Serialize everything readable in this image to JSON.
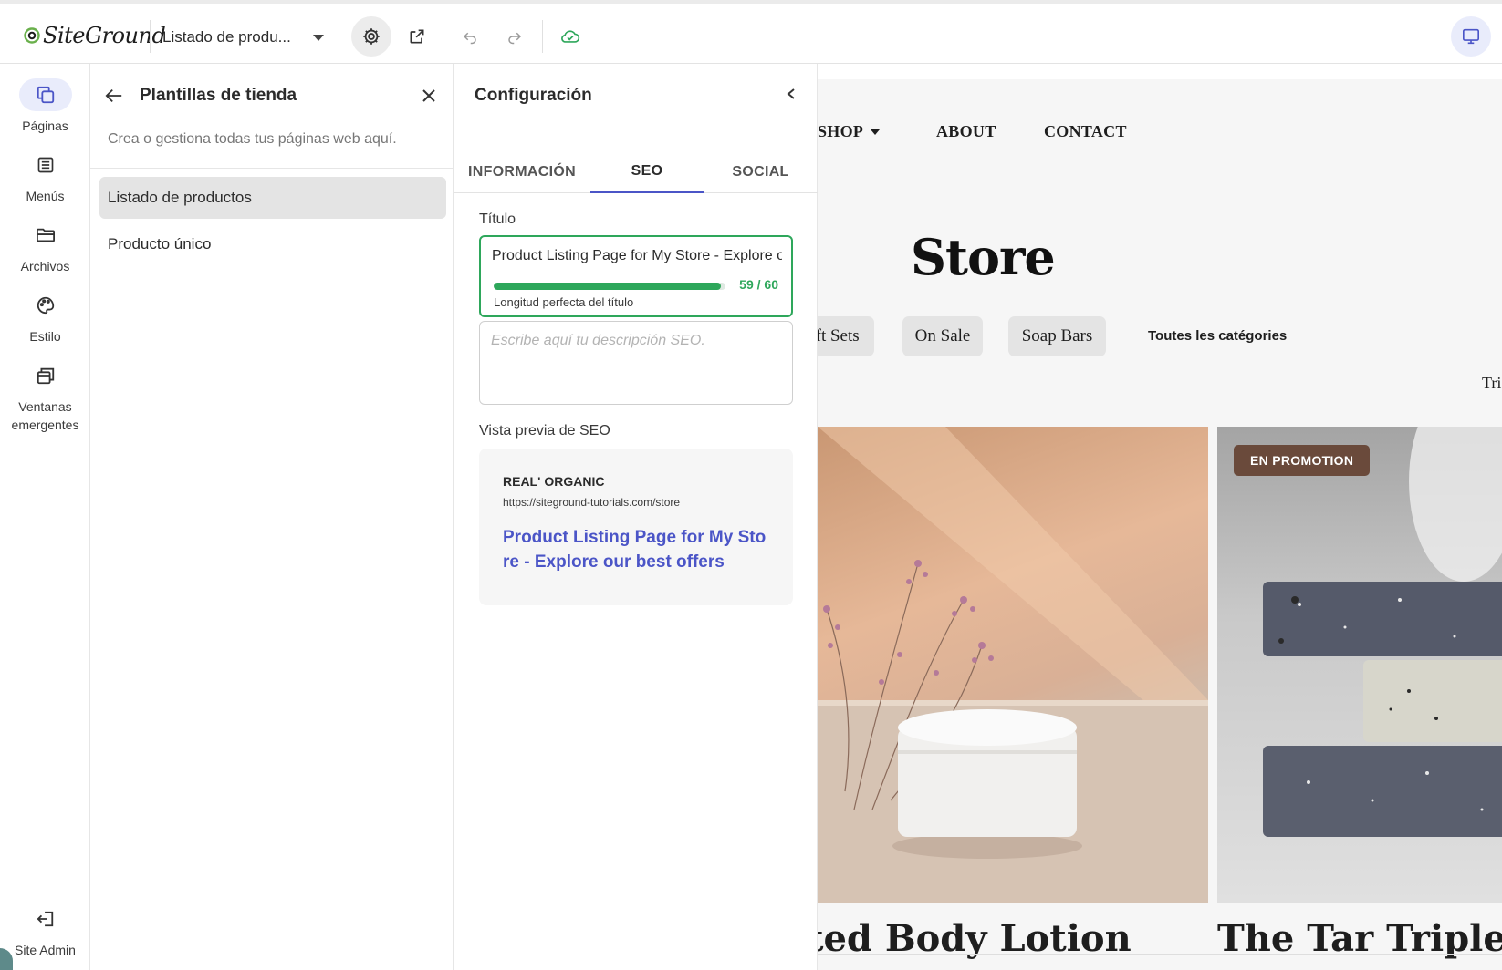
{
  "topbar": {
    "logo_text": "SiteGround",
    "page_select": "Listado de produ...",
    "icons": [
      "settings-icon",
      "open-external-icon",
      "undo-icon",
      "redo-icon",
      "cloud-saved-icon",
      "desktop-view-icon"
    ]
  },
  "rail": {
    "items": [
      {
        "label": "Páginas",
        "icon": "pages-icon"
      },
      {
        "label": "Menús",
        "icon": "menu-list-icon"
      },
      {
        "label": "Archivos",
        "icon": "folder-icon"
      },
      {
        "label": "Estilo",
        "icon": "palette-icon"
      },
      {
        "label": "Ventanas emergentes",
        "icon": "popup-window-icon"
      }
    ],
    "site_admin": "Site Admin"
  },
  "templates": {
    "title": "Plantillas de tienda",
    "subtitle": "Crea o gestiona todas tus páginas web aquí.",
    "items": [
      {
        "label": "Listado de productos",
        "selected": true
      },
      {
        "label": "Producto único",
        "selected": false
      }
    ]
  },
  "config": {
    "title": "Configuración",
    "tabs": [
      {
        "label": "INFORMACIÓN",
        "active": false
      },
      {
        "label": "SEO",
        "active": true
      },
      {
        "label": "SOCIAL",
        "active": false
      }
    ],
    "title_label": "Título",
    "title_value": "Product Listing Page for My Store - Explore our best offers",
    "title_progress": 0.98,
    "title_count": "59 / 60",
    "title_message": "Longitud perfecta del título",
    "description_placeholder": "Escribe aquí tu descripción SEO.",
    "preview_label": "Vista previa de SEO",
    "preview": {
      "site": "REAL' ORGANIC",
      "url": "https://siteground-tutorials.com/store",
      "title": "Product Listing Page for My Store - Explore our best offers"
    },
    "accent_color": "#4b55c7",
    "success_color": "#2ea75b"
  },
  "canvas": {
    "nav": [
      "SHOP",
      "ABOUT",
      "CONTACT"
    ],
    "heading": "Store",
    "chips": [
      "ift Sets",
      "On Sale",
      "Soap Bars"
    ],
    "all_categories": "Toutes les catégories",
    "sort_peek": "Tri",
    "badge": "EN PROMOTION",
    "products": [
      "ted Body Lotion",
      "The Tar Triplet"
    ]
  }
}
